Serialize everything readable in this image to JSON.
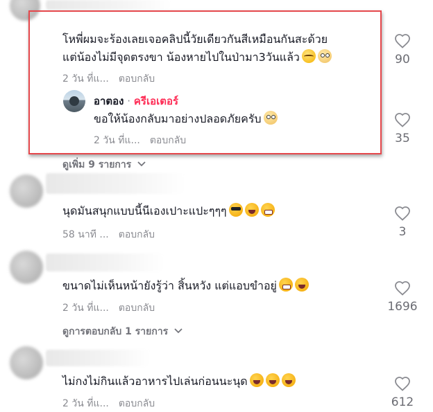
{
  "comments": [
    {
      "text_lines": [
        "โหพี่ผมจะร้องเลยเจอคลิปนี้วัยเดียวกันสีเหมือนกันสะด้วย",
        "แต่น้องไม่มีจุดตรงขา น้องหายไปในป่ามา3วันแล้ว"
      ],
      "time": "2 วัน ที่แ...",
      "reply_label": "ตอบกลับ",
      "likes": "90",
      "emojis": [
        "face-holding-back-tears-emoji",
        "flushed-face-emoji"
      ]
    },
    {
      "text_lines": [
        "นุดมันสนุกแบบนี้นีเองเปาะแปะๆๆๆ"
      ],
      "time": "58 นาที ...",
      "reply_label": "ตอบกลับ",
      "likes": "3",
      "emojis": [
        "smiling-face-with-sunglasses-emoji",
        "laughing-emoji",
        "grinning-emoji"
      ]
    },
    {
      "text_lines": [
        "ขนาดไม่เห็นหน้ายังรู้ว่า สิ้นหวัง แต่แอบขำอยู่"
      ],
      "time": "2 วัน ที่แ...",
      "reply_label": "ตอบกลับ",
      "likes": "1696",
      "emojis": [
        "grinning-emoji",
        "laughing-emoji"
      ],
      "view_replies": "ดูการตอบกลับ 1 รายการ"
    },
    {
      "text_lines": [
        "ไม่กงไม่กินแล้วอาหารไปเล่นก่อนนะนุด"
      ],
      "time": "2 วัน ที่แ...",
      "reply_label": "ตอบกลับ",
      "likes": "612",
      "emojis": [
        "laughing-emoji",
        "laughing-emoji",
        "laughing-emoji"
      ]
    }
  ],
  "reply": {
    "author": "อาตอง",
    "separator": "·",
    "creator_badge": "ครีเอเตอร์",
    "text": "ขอให้น้องกลับมาอย่างปลอดภัยครับ",
    "time": "2 วัน ที่แ...",
    "reply_label": "ตอบกลับ",
    "likes": "35",
    "emojis": [
      "pleading-face-emoji"
    ]
  },
  "view_more": "ดูเพิ่ม 9 รายการ",
  "colors": {
    "text": "#161823",
    "meta": "#8a8b91",
    "creator": "#fe2c55",
    "highlight_border": "#e5474b",
    "like_count": "#6b6c73"
  }
}
